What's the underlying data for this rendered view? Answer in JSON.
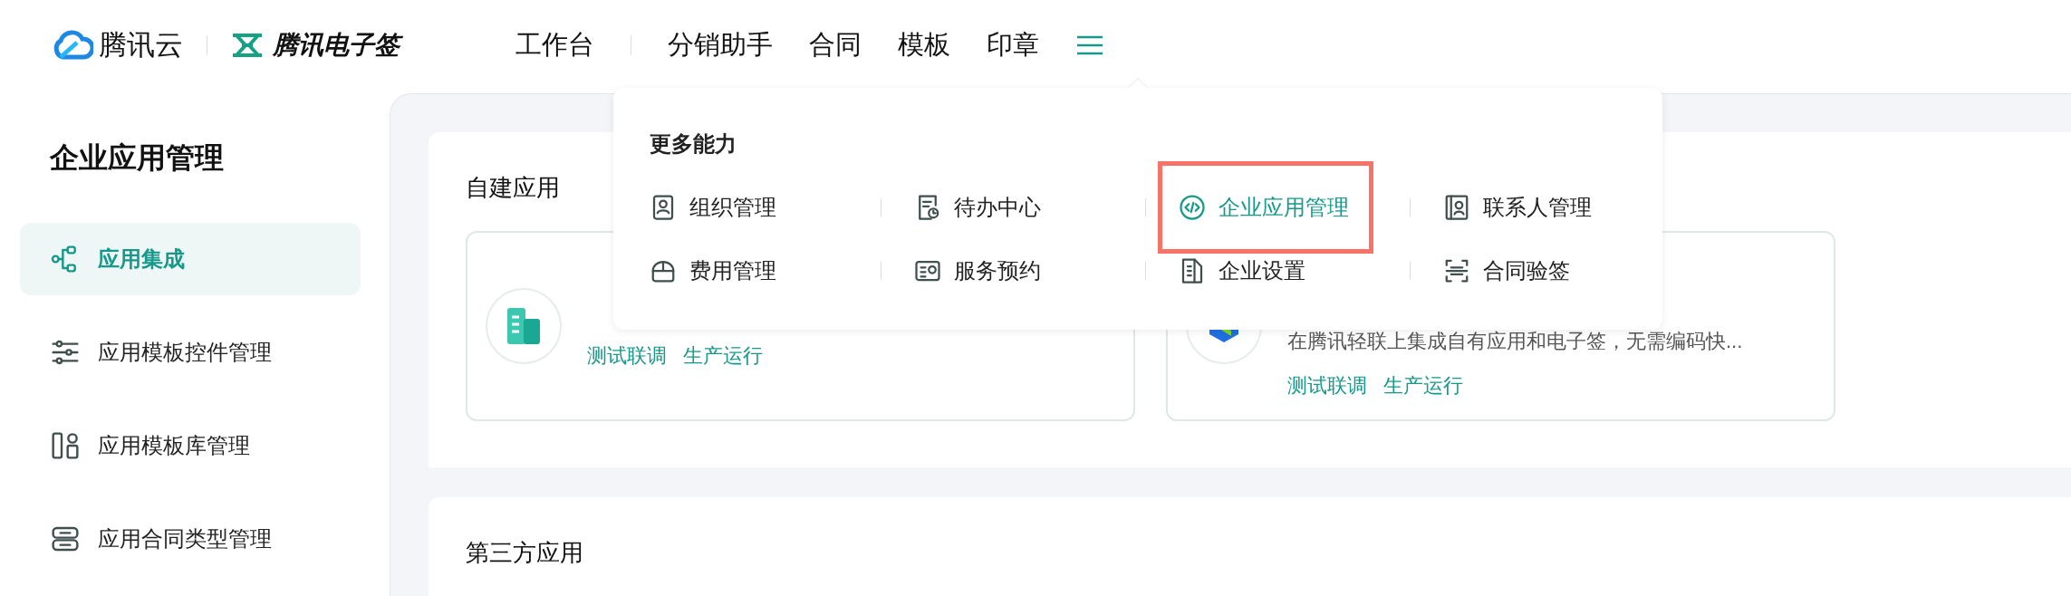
{
  "header": {
    "logo": "腾讯云",
    "product": "腾讯电子签",
    "nav": [
      {
        "label": "工作台",
        "selected": false
      },
      {
        "label": "分销助手",
        "selected": false
      },
      {
        "label": "合同",
        "selected": false
      },
      {
        "label": "模板",
        "selected": false
      },
      {
        "label": "印章",
        "selected": false
      }
    ]
  },
  "more_menu": {
    "title": "更多能力",
    "items": [
      {
        "label": "组织管理",
        "selected": false,
        "highlighted": false
      },
      {
        "label": "待办中心",
        "selected": false,
        "highlighted": false
      },
      {
        "label": "企业应用管理",
        "selected": true,
        "highlighted": true
      },
      {
        "label": "联系人管理",
        "selected": false,
        "highlighted": false
      },
      {
        "label": "费用管理",
        "selected": false,
        "highlighted": false
      },
      {
        "label": "服务预约",
        "selected": false,
        "highlighted": false
      },
      {
        "label": "企业设置",
        "selected": false,
        "highlighted": false
      },
      {
        "label": "合同验签",
        "selected": false,
        "highlighted": false
      }
    ]
  },
  "sidebar": {
    "title": "企业应用管理",
    "items": [
      {
        "label": "应用集成",
        "selected": true
      },
      {
        "label": "应用模板控件管理",
        "selected": false
      },
      {
        "label": "应用模板库管理",
        "selected": false
      },
      {
        "label": "应用合同类型管理",
        "selected": false
      }
    ]
  },
  "sections": [
    {
      "title": "自建应用",
      "cards": [
        {
          "links": [
            "测试联调",
            "生产运行"
          ]
        },
        {
          "description": "在腾讯轻联上集成自有应用和电子签，无需编码快...",
          "links": [
            "测试联调",
            "生产运行"
          ]
        }
      ]
    },
    {
      "title": "第三方应用"
    }
  ]
}
